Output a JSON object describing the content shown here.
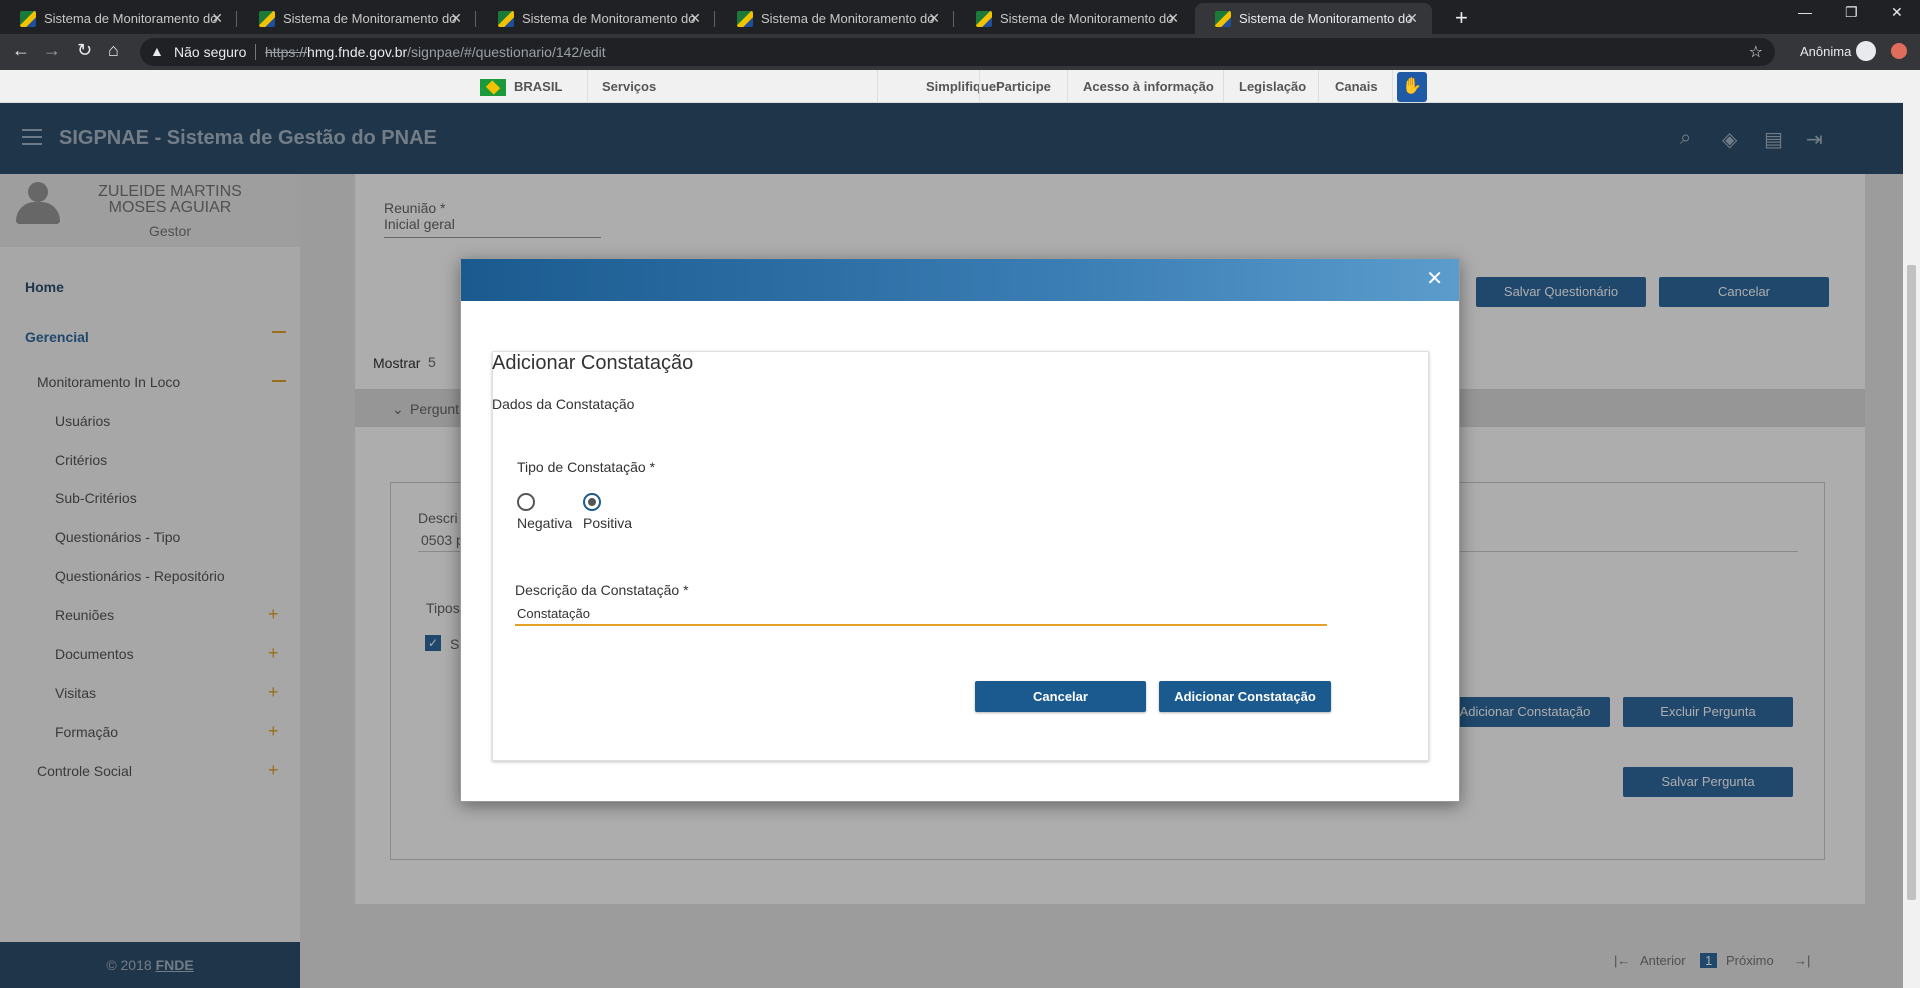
{
  "browser": {
    "tabs": [
      {
        "title": "Sistema de Monitoramento do PNAE",
        "active": false
      },
      {
        "title": "Sistema de Monitoramento do PNAE",
        "active": false
      },
      {
        "title": "Sistema de Monitoramento do PNAE",
        "active": false
      },
      {
        "title": "Sistema de Monitoramento do PNAE",
        "active": false
      },
      {
        "title": "Sistema de Monitoramento do PNAE",
        "active": false
      },
      {
        "title": "Sistema de Monitoramento do PNAE",
        "active": true
      }
    ],
    "security_label": "Não seguro",
    "url_proto": "https://",
    "url_host": "hmg.fnde.gov.br",
    "url_path": "/signpae/#/questionario/142/edit",
    "profile_label": "Anônima"
  },
  "govbar": {
    "brasil": "BRASIL",
    "servicos": "Serviços",
    "simplifique": "Simplifique!",
    "participe": "Participe",
    "acesso": "Acesso à informação",
    "legislacao": "Legislação",
    "canais": "Canais"
  },
  "header": {
    "title": "SIGPNAE - Sistema de Gestão do PNAE"
  },
  "sidebar": {
    "user_name_line1": "ZULEIDE MARTINS",
    "user_name_line2": "MOSES AGUIAR",
    "user_role": "Gestor",
    "items": {
      "home": "Home",
      "gerencial": "Gerencial",
      "monitoramento": "Monitoramento In Loco",
      "usuarios": "Usuários",
      "criterios": "Critérios",
      "subcriterios": "Sub-Critérios",
      "questionarios_tipo": "Questionários - Tipo",
      "questionarios_repo": "Questionários - Repositório",
      "reunioes": "Reuniões",
      "documentos": "Documentos",
      "visitas": "Visitas",
      "formacao": "Formação",
      "controle_social": "Controle Social"
    },
    "footer_prefix": "© 2018",
    "footer_brand": "FNDE"
  },
  "main": {
    "reuniao_label": "Reunião *",
    "reuniao_value": "Inicial geral",
    "salvar_questionario": "Salvar Questionário",
    "cancelar": "Cancelar",
    "mostrar_label": "Mostrar",
    "mostrar_value": "5",
    "pergunta_label": "Pergunt",
    "descr_label": "Descri",
    "descr_value": "0503 p",
    "tipos_label": "Tipos",
    "checkbox_label": "S",
    "adicionar_constatacao": "Adicionar Constatação",
    "excluir_pergunta": "Excluir Pergunta",
    "salvar_pergunta": "Salvar Pergunta",
    "pager_anterior": "Anterior",
    "pager_page": "1",
    "pager_proximo": "Próximo"
  },
  "modal": {
    "title": "Adicionar Constatação",
    "subtitle": "Dados da Constatação",
    "tipo_label": "Tipo de Constatação *",
    "options": [
      {
        "label": "Negativa",
        "checked": false
      },
      {
        "label": "Positiva",
        "checked": true
      }
    ],
    "descricao_label": "Descrição da Constatação *",
    "descricao_value": "Constatação",
    "cancel_label": "Cancelar",
    "submit_label": "Adicionar Constatação"
  }
}
